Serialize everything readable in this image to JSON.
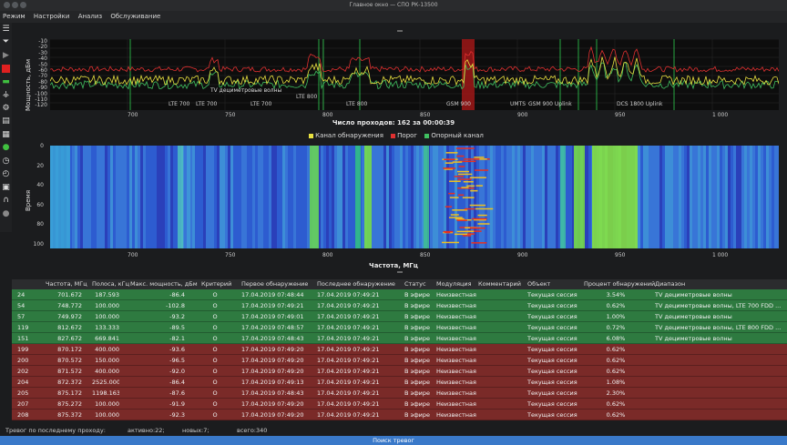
{
  "window": {
    "title": "Главное окно — СПО РК-13500"
  },
  "menu": [
    "Режим",
    "Настройки",
    "Анализ",
    "Обслуживание"
  ],
  "toolbar": {
    "icons": [
      "menu-icon",
      "filter-icon",
      "play-icon",
      "stop-icon",
      "record-icon",
      "antenna-icon",
      "gear-icon",
      "chart-icon",
      "report-icon",
      "marker-icon",
      "clock-icon",
      "timer-icon",
      "export-icon",
      "headphones-icon",
      "circle-icon"
    ]
  },
  "spectrum": {
    "ylabel": "Мощность, дБм",
    "yticks": [
      "-10",
      "-20",
      "-30",
      "-40",
      "-50",
      "-60",
      "-70",
      "-80",
      "-90",
      "-100",
      "-110",
      "-120"
    ],
    "xticks": [
      "700",
      "750",
      "800",
      "850",
      "900",
      "950",
      "1 000"
    ],
    "annotations": [
      "TV дециметровые волны",
      "LTE 700",
      "LTE 700",
      "LTE 700",
      "LTE 800",
      "LTE 800",
      "GSM 900",
      "UMTS",
      "GSM 900 Uplink",
      "DCS 1800 Uplink"
    ],
    "passes_text": "Число проходов: 162 за 00:00:39",
    "legend": [
      {
        "label": "Канал обнаружения",
        "color": "#e8e040"
      },
      {
        "label": "Порог",
        "color": "#e03030"
      },
      {
        "label": "Опорный канал",
        "color": "#40c060"
      }
    ]
  },
  "waterfall": {
    "ylabel": "Время",
    "yticks": [
      "0",
      "20",
      "40",
      "60",
      "80",
      "100"
    ],
    "xticks": [
      "700",
      "750",
      "800",
      "850",
      "900",
      "950",
      "1 000"
    ],
    "xlabel": "Частота, МГц"
  },
  "table": {
    "headers": [
      "Частота, МГц",
      "Полоса, кГц",
      "Макс. мощность, дБм",
      "Критерий",
      "Первое обнаружение",
      "Последнее обнаружение",
      "Статус",
      "Модуляция",
      "Комментарий",
      "Объект",
      "Процент обнаружений",
      "Диапазон"
    ],
    "rows": [
      {
        "id": "24",
        "freq": "701.672",
        "band": "187.593",
        "pwr": "-86.4",
        "crit": "O",
        "first": "17.04.2019 07:48:44",
        "last": "17.04.2019 07:49:21",
        "status": "В эфире",
        "mod": "Неизвестная",
        "comment": "",
        "object": "Текущая сессия",
        "pct": "3.54%",
        "range": "TV дециметровые волны",
        "color": "green"
      },
      {
        "id": "54",
        "freq": "748.772",
        "band": "100.000",
        "pwr": "-102.8",
        "crit": "O",
        "first": "17.04.2019 07:49:21",
        "last": "17.04.2019 07:49:21",
        "status": "В эфире",
        "mod": "Неизвестная",
        "comment": "",
        "object": "Текущая сессия",
        "pct": "0.62%",
        "range": "TV дециметровые волны, LTE 700 FDD ...",
        "color": "green"
      },
      {
        "id": "57",
        "freq": "749.972",
        "band": "100.000",
        "pwr": "-93.2",
        "crit": "O",
        "first": "17.04.2019 07:49:01",
        "last": "17.04.2019 07:49:21",
        "status": "В эфире",
        "mod": "Неизвестная",
        "comment": "",
        "object": "Текущая сессия",
        "pct": "1.00%",
        "range": "TV дециметровые волны",
        "color": "green"
      },
      {
        "id": "119",
        "freq": "812.672",
        "band": "133.333",
        "pwr": "-89.5",
        "crit": "O",
        "first": "17.04.2019 07:48:57",
        "last": "17.04.2019 07:49:21",
        "status": "В эфире",
        "mod": "Неизвестная",
        "comment": "",
        "object": "Текущая сессия",
        "pct": "0.72%",
        "range": "TV дециметровые волны, LTE 800 FDD ...",
        "color": "green"
      },
      {
        "id": "151",
        "freq": "827.672",
        "band": "669.841",
        "pwr": "-82.1",
        "crit": "O",
        "first": "17.04.2019 07:48:43",
        "last": "17.04.2019 07:49:21",
        "status": "В эфире",
        "mod": "Неизвестная",
        "comment": "",
        "object": "Текущая сессия",
        "pct": "6.08%",
        "range": "TV дециметровые волны",
        "color": "green"
      },
      {
        "id": "199",
        "freq": "870.172",
        "band": "400.000",
        "pwr": "-93.6",
        "crit": "O",
        "first": "17.04.2019 07:49:20",
        "last": "17.04.2019 07:49:21",
        "status": "В эфире",
        "mod": "Неизвестная",
        "comment": "",
        "object": "Текущая сессия",
        "pct": "0.62%",
        "range": "",
        "color": "red"
      },
      {
        "id": "200",
        "freq": "870.572",
        "band": "150.000",
        "pwr": "-96.5",
        "crit": "O",
        "first": "17.04.2019 07:49:20",
        "last": "17.04.2019 07:49:21",
        "status": "В эфире",
        "mod": "Неизвестная",
        "comment": "",
        "object": "Текущая сессия",
        "pct": "0.62%",
        "range": "",
        "color": "red"
      },
      {
        "id": "202",
        "freq": "871.572",
        "band": "400.000",
        "pwr": "-92.0",
        "crit": "O",
        "first": "17.04.2019 07:49:20",
        "last": "17.04.2019 07:49:21",
        "status": "В эфире",
        "mod": "Неизвестная",
        "comment": "",
        "object": "Текущая сессия",
        "pct": "0.62%",
        "range": "",
        "color": "red"
      },
      {
        "id": "204",
        "freq": "872.372",
        "band": "2525.000",
        "pwr": "-86.4",
        "crit": "O",
        "first": "17.04.2019 07:49:13",
        "last": "17.04.2019 07:49:21",
        "status": "В эфире",
        "mod": "Неизвестная",
        "comment": "",
        "object": "Текущая сессия",
        "pct": "1.08%",
        "range": "",
        "color": "red"
      },
      {
        "id": "205",
        "freq": "875.172",
        "band": "1198.163",
        "pwr": "-87.6",
        "crit": "O",
        "first": "17.04.2019 07:48:43",
        "last": "17.04.2019 07:49:21",
        "status": "В эфире",
        "mod": "Неизвестная",
        "comment": "",
        "object": "Текущая сессия",
        "pct": "2.30%",
        "range": "",
        "color": "red"
      },
      {
        "id": "207",
        "freq": "875.272",
        "band": "100.000",
        "pwr": "-91.9",
        "crit": "O",
        "first": "17.04.2019 07:49:20",
        "last": "17.04.2019 07:49:21",
        "status": "В эфире",
        "mod": "Неизвестная",
        "comment": "",
        "object": "Текущая сессия",
        "pct": "0.62%",
        "range": "",
        "color": "red"
      },
      {
        "id": "208",
        "freq": "875.372",
        "band": "100.000",
        "pwr": "-92.3",
        "crit": "O",
        "first": "17.04.2019 07:49:20",
        "last": "17.04.2019 07:49:21",
        "status": "В эфире",
        "mod": "Неизвестная",
        "comment": "",
        "object": "Текущая сессия",
        "pct": "0.62%",
        "range": "",
        "color": "red"
      }
    ]
  },
  "status": {
    "alarms": "Тревог по последнему проходу:",
    "active": "активно:22;",
    "new": "новых:7;",
    "total": "всего:340"
  },
  "bottom_button": "Поиск тревог",
  "colors": {
    "row_green": "#2e7a40",
    "row_red": "#7a2a28",
    "accent": "#3a79c9"
  }
}
